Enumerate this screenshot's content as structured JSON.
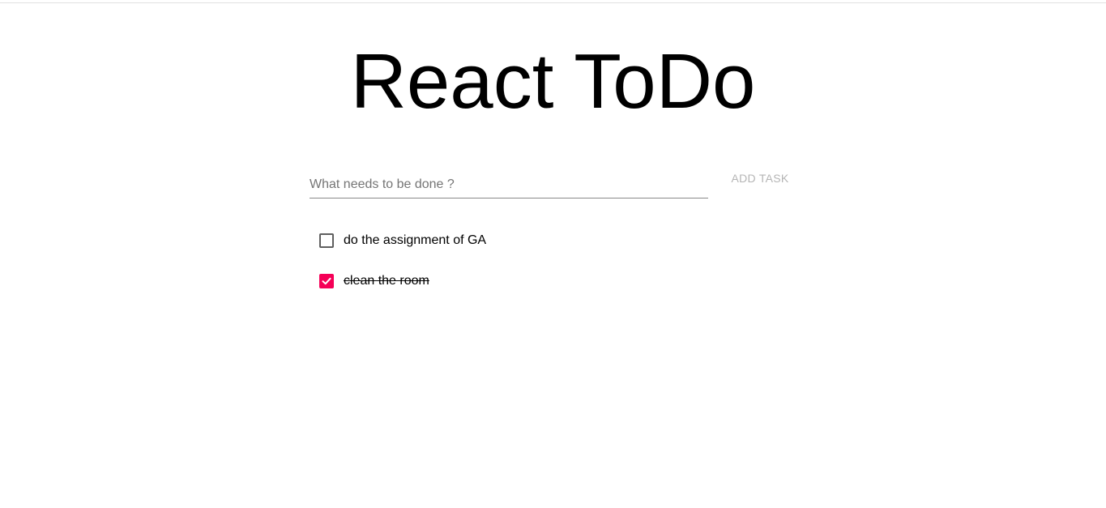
{
  "app": {
    "title": "React ToDo"
  },
  "form": {
    "input_value": "",
    "input_placeholder": "What needs to be done ?",
    "add_button_label": "ADD TASK"
  },
  "todos": [
    {
      "text": "do the assignment of GA",
      "completed": false
    },
    {
      "text": "clean the room",
      "completed": true
    }
  ],
  "colors": {
    "accent": "#f50057",
    "disabled_button": "#b5b5b5"
  }
}
